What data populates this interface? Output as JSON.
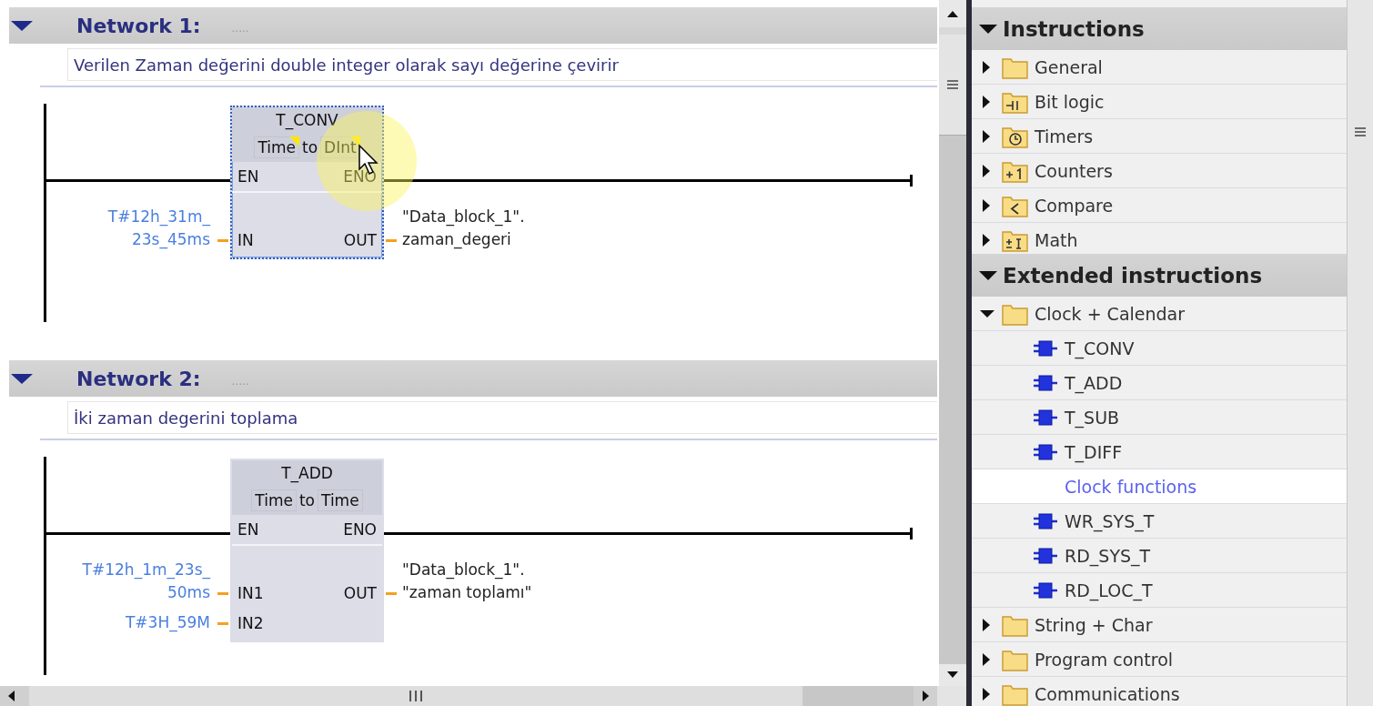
{
  "editor": {
    "networks": [
      {
        "title": "Network 1:",
        "title_placeholder": ".....",
        "expanded": true,
        "comment": "Verilen Zaman değerini double integer olarak sayı değerine çevirir",
        "block": {
          "name": "T_CONV",
          "types": [
            "Time",
            "DInt"
          ],
          "connector": "to",
          "selected": true,
          "enable_in": "EN",
          "enable_out": "ENO",
          "inputs": [
            {
              "pin": "IN",
              "operand": [
                "T#12h_31m_",
                "23s_45ms"
              ]
            }
          ],
          "outputs": [
            {
              "pin": "OUT",
              "operand": [
                "\"Data_block_1\".",
                "zaman_degeri"
              ]
            }
          ]
        }
      },
      {
        "title": "Network 2:",
        "title_placeholder": ".....",
        "expanded": true,
        "comment": "İki zaman degerini toplama",
        "block": {
          "name": "T_ADD",
          "types": [
            "Time",
            "Time"
          ],
          "connector": "to",
          "selected": false,
          "enable_in": "EN",
          "enable_out": "ENO",
          "inputs": [
            {
              "pin": "IN1",
              "operand": [
                "T#12h_1m_23s_",
                "50ms"
              ]
            },
            {
              "pin": "IN2",
              "operand": [
                "T#3H_59M"
              ]
            }
          ],
          "outputs": [
            {
              "pin": "OUT",
              "operand": [
                "\"Data_block_1\".",
                "\"zaman toplamı\""
              ]
            }
          ]
        }
      }
    ]
  },
  "panel": {
    "sections": [
      {
        "title": "Instructions",
        "expanded": true,
        "items": [
          {
            "kind": "folder",
            "label": "General",
            "expanded": false
          },
          {
            "kind": "bitlogic",
            "label": "Bit logic",
            "expanded": false
          },
          {
            "kind": "timer",
            "label": "Timers",
            "expanded": false
          },
          {
            "kind": "counter",
            "label": "Counters",
            "expanded": false
          },
          {
            "kind": "compare",
            "label": "Compare",
            "expanded": false
          },
          {
            "kind": "math",
            "label": "Math",
            "expanded": false
          }
        ]
      },
      {
        "title": "Extended instructions",
        "expanded": true,
        "items": [
          {
            "kind": "folder",
            "label": "Clock + Calendar",
            "expanded": true,
            "children": [
              {
                "kind": "block",
                "label": "T_CONV"
              },
              {
                "kind": "block",
                "label": "T_ADD"
              },
              {
                "kind": "block",
                "label": "T_SUB"
              },
              {
                "kind": "block",
                "label": "T_DIFF"
              },
              {
                "kind": "link",
                "label": "Clock functions"
              },
              {
                "kind": "block",
                "label": "WR_SYS_T"
              },
              {
                "kind": "block",
                "label": "RD_SYS_T"
              },
              {
                "kind": "block",
                "label": "RD_LOC_T"
              }
            ]
          },
          {
            "kind": "folder",
            "label": "String + Char",
            "expanded": false
          },
          {
            "kind": "folder",
            "label": "Program control",
            "expanded": false
          },
          {
            "kind": "folder",
            "label": "Communications",
            "expanded": false
          }
        ]
      }
    ]
  }
}
